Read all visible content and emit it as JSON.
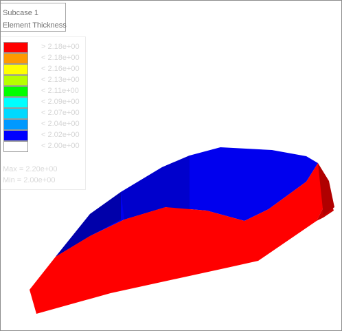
{
  "header": {
    "subcase": "Subcase 1",
    "result": "Element Thickness"
  },
  "legend": {
    "items": [
      {
        "color": "#ff0000",
        "label": "> 2.18e+00"
      },
      {
        "color": "#ff9900",
        "label": "< 2.18e+00"
      },
      {
        "color": "#ffff00",
        "label": "< 2.16e+00"
      },
      {
        "color": "#b7ff00",
        "label": "< 2.13e+00"
      },
      {
        "color": "#00ff00",
        "label": "< 2.11e+00"
      },
      {
        "color": "#00ffff",
        "label": "< 2.09e+00"
      },
      {
        "color": "#00d9ff",
        "label": "< 2.07e+00"
      },
      {
        "color": "#0099ff",
        "label": "< 2.04e+00"
      },
      {
        "color": "#0000ff",
        "label": "< 2.02e+00"
      },
      {
        "color": "#ffffff",
        "label": "< 2.00e+00"
      }
    ],
    "max": "Max = 2.20e+00",
    "min": "Min = 2.00e+00"
  },
  "model_colors": {
    "top": "#0000ee",
    "top_dark": "#0000aa",
    "side": "#ff0000",
    "side_dark": "#c80000"
  }
}
